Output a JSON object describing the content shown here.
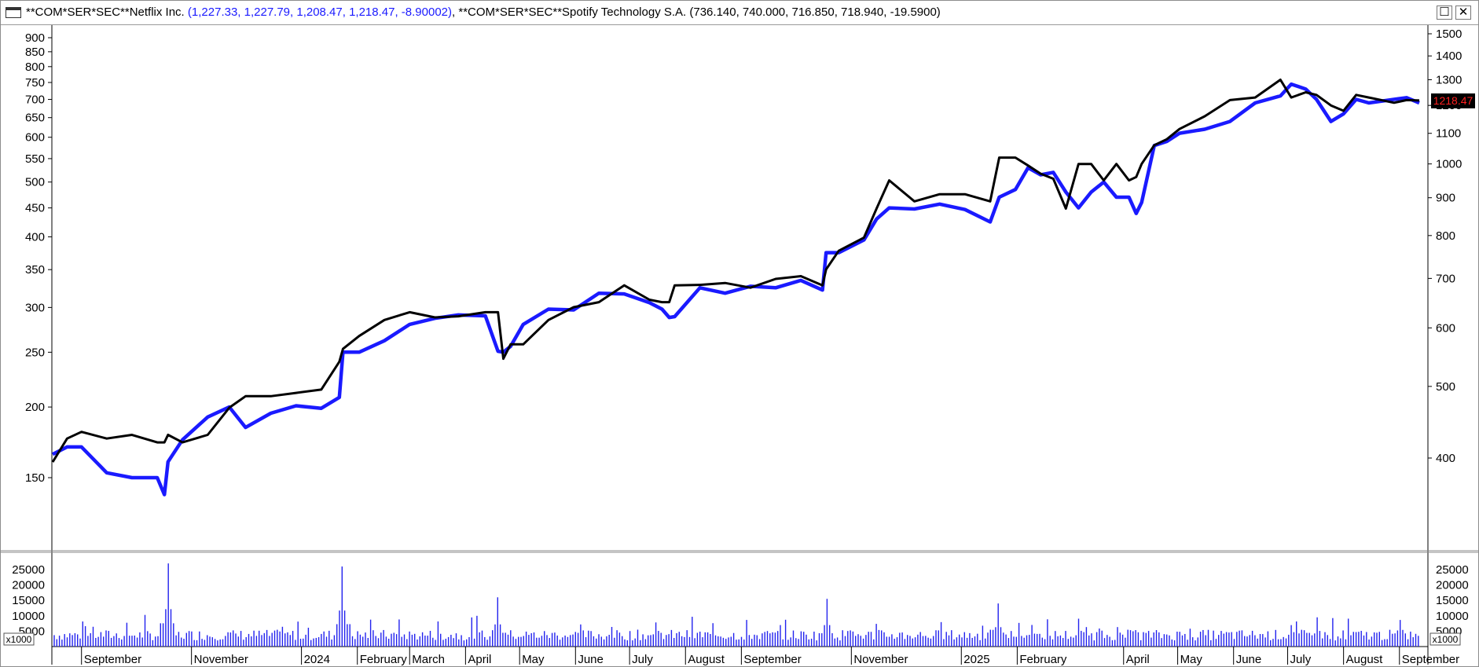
{
  "window": {
    "title_prefix_1": "**COM*SER*SEC**Netflix  Inc. ",
    "title_vals_1": "(1,227.33, 1,227.79, 1,208.47, 1,218.47, -8.90002)",
    "title_prefix_2": ", **COM*SER*SEC**Spotify Technology S.A. (736.140, 740.000, 716.850, 718.940, -19.5900)",
    "maximize_glyph": "☐",
    "close_glyph": "✕"
  },
  "last_price_label": "1218.47",
  "colors": {
    "spotify": "#1a1aff",
    "netflix": "#000000",
    "volume": "#2222ee",
    "last_price_bg": "#000000",
    "last_price_text": "#ff2020"
  },
  "left_axis": {
    "ticks": [
      "900",
      "850",
      "800",
      "750",
      "700",
      "650",
      "600",
      "550",
      "500",
      "450",
      "400",
      "350",
      "300",
      "250",
      "200",
      "150"
    ]
  },
  "right_axis": {
    "ticks": [
      "1500",
      "1400",
      "1300",
      "1200",
      "1100",
      "1000",
      "900",
      "800",
      "700",
      "600",
      "500",
      "400"
    ]
  },
  "volume_axis": {
    "ticks": [
      "25000",
      "20000",
      "15000",
      "10000",
      "5000"
    ],
    "multiplier": "x1000"
  },
  "x_axis": {
    "labels": [
      "September",
      "November",
      "2024",
      "February",
      "March",
      "April",
      "May",
      "June",
      "July",
      "August",
      "September",
      "November",
      "2025",
      "February",
      "April",
      "May",
      "June",
      "July",
      "August",
      "September"
    ]
  },
  "chart_data": {
    "type": "line",
    "x": [
      "2023-08-16",
      "2023-08-24",
      "2023-09-01",
      "2023-09-15",
      "2023-09-29",
      "2023-10-13",
      "2023-10-17",
      "2023-10-19",
      "2023-10-27",
      "2023-11-10",
      "2023-11-22",
      "2023-12-01",
      "2023-12-15",
      "2023-12-29",
      "2024-01-12",
      "2024-01-22",
      "2024-01-24",
      "2024-02-02",
      "2024-02-16",
      "2024-03-01",
      "2024-03-15",
      "2024-03-28",
      "2024-04-12",
      "2024-04-19",
      "2024-04-22",
      "2024-04-26",
      "2024-05-03",
      "2024-05-17",
      "2024-05-31",
      "2024-06-14",
      "2024-06-28",
      "2024-07-12",
      "2024-07-19",
      "2024-07-23",
      "2024-07-26",
      "2024-08-09",
      "2024-08-23",
      "2024-09-06",
      "2024-09-20",
      "2024-10-04",
      "2024-10-16",
      "2024-10-18",
      "2024-10-25",
      "2024-11-08",
      "2024-11-15",
      "2024-11-22",
      "2024-12-06",
      "2024-12-20",
      "2025-01-03",
      "2025-01-17",
      "2025-01-22",
      "2025-01-31",
      "2025-02-07",
      "2025-02-14",
      "2025-02-21",
      "2025-02-28",
      "2025-03-07",
      "2025-03-14",
      "2025-03-21",
      "2025-03-28",
      "2025-04-04",
      "2025-04-08",
      "2025-04-11",
      "2025-04-18",
      "2025-04-25",
      "2025-05-02",
      "2025-05-16",
      "2025-05-30",
      "2025-06-13",
      "2025-06-27",
      "2025-07-03",
      "2025-07-11",
      "2025-07-17",
      "2025-07-25",
      "2025-08-01",
      "2025-08-08",
      "2025-08-15",
      "2025-08-29",
      "2025-09-05",
      "2025-09-12"
    ],
    "series": [
      {
        "axis": "left",
        "color": "#1a1aff",
        "values": [
          165,
          170,
          170,
          153,
          150,
          150,
          140,
          160,
          175,
          192,
          200,
          184,
          195,
          201,
          199,
          208,
          250,
          250,
          262,
          280,
          287,
          291,
          290,
          251,
          250,
          256,
          280,
          298,
          297,
          318,
          317,
          306,
          298,
          288,
          289,
          325,
          318,
          327,
          325,
          335,
          322,
          375,
          375,
          395,
          430,
          450,
          448,
          457,
          447,
          425,
          470,
          485,
          530,
          515,
          520,
          480,
          450,
          480,
          500,
          470,
          470,
          440,
          460,
          580,
          590,
          610,
          620,
          640,
          690,
          710,
          745,
          730,
          700,
          640,
          660,
          700,
          690,
          700,
          705,
          690
        ]
      },
      {
        "axis": "right",
        "color": "#000000",
        "values": [
          395,
          425,
          434,
          425,
          430,
          420,
          420,
          430,
          420,
          430,
          468,
          485,
          485,
          490,
          495,
          540,
          562,
          585,
          615,
          630,
          620,
          622,
          630,
          630,
          545,
          570,
          570,
          615,
          640,
          650,
          685,
          655,
          650,
          650,
          685,
          686,
          690,
          680,
          699,
          705,
          685,
          720,
          763,
          795,
          870,
          950,
          890,
          910,
          910,
          890,
          1020,
          1020,
          995,
          970,
          955,
          870,
          1000,
          1000,
          950,
          1000,
          950,
          960,
          1000,
          1060,
          1080,
          1115,
          1160,
          1220,
          1230,
          1300,
          1230,
          1250,
          1240,
          1200,
          1180,
          1240,
          1230,
          1210,
          1220,
          1218.47
        ]
      }
    ],
    "left_ylim": [
      130,
      950
    ],
    "right_ylim": [
      320,
      1540
    ],
    "volume": {
      "unit": "x1000",
      "spikes": [
        {
          "date": "2023-10-19",
          "value": 27000
        },
        {
          "date": "2024-01-24",
          "value": 26000
        },
        {
          "date": "2024-04-19",
          "value": 16000
        },
        {
          "date": "2024-10-18",
          "value": 15500
        },
        {
          "date": "2025-01-22",
          "value": 14000
        },
        {
          "date": "2025-07-18",
          "value": 9500
        }
      ]
    }
  }
}
